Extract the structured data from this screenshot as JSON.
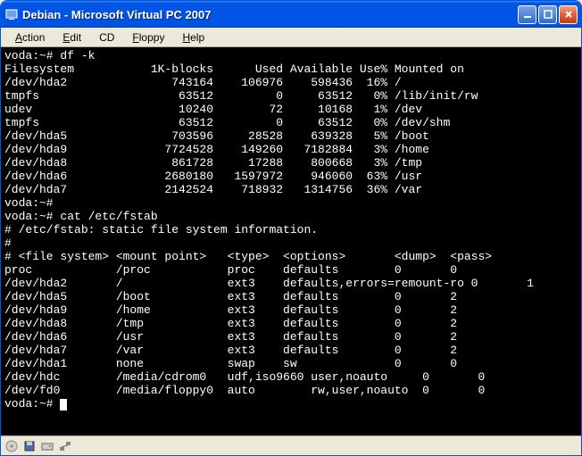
{
  "window": {
    "title": "Debian - Microsoft Virtual PC 2007"
  },
  "menu": {
    "action": "Action",
    "edit": "Edit",
    "cd": "CD",
    "floppy": "Floppy",
    "help": "Help"
  },
  "terminal": {
    "prompt1": "voda:~# df -k",
    "df_header": "Filesystem           1K-blocks      Used Available Use% Mounted on",
    "df_rows": [
      {
        "fs": "/dev/hda2",
        "blocks": "743164",
        "used": "106976",
        "avail": "598436",
        "usep": "16%",
        "mount": "/"
      },
      {
        "fs": "tmpfs",
        "blocks": "63512",
        "used": "0",
        "avail": "63512",
        "usep": "0%",
        "mount": "/lib/init/rw"
      },
      {
        "fs": "udev",
        "blocks": "10240",
        "used": "72",
        "avail": "10168",
        "usep": "1%",
        "mount": "/dev"
      },
      {
        "fs": "tmpfs",
        "blocks": "63512",
        "used": "0",
        "avail": "63512",
        "usep": "0%",
        "mount": "/dev/shm"
      },
      {
        "fs": "/dev/hda5",
        "blocks": "703596",
        "used": "28528",
        "avail": "639328",
        "usep": "5%",
        "mount": "/boot"
      },
      {
        "fs": "/dev/hda9",
        "blocks": "7724528",
        "used": "149260",
        "avail": "7182884",
        "usep": "3%",
        "mount": "/home"
      },
      {
        "fs": "/dev/hda8",
        "blocks": "861728",
        "used": "17288",
        "avail": "800668",
        "usep": "3%",
        "mount": "/tmp"
      },
      {
        "fs": "/dev/hda6",
        "blocks": "2680180",
        "used": "1597972",
        "avail": "946060",
        "usep": "63%",
        "mount": "/usr"
      },
      {
        "fs": "/dev/hda7",
        "blocks": "2142524",
        "used": "718932",
        "avail": "1314756",
        "usep": "36%",
        "mount": "/var"
      }
    ],
    "prompt2": "voda:~#",
    "prompt3": "voda:~# cat /etc/fstab",
    "fstab_comment1": "# /etc/fstab: static file system information.",
    "fstab_comment2": "#",
    "fstab_header": "# <file system> <mount point>   <type>  <options>       <dump>  <pass>",
    "fstab_rows": [
      {
        "fs": "proc",
        "mp": "/proc",
        "type": "proc",
        "opts": "defaults",
        "dump": "0",
        "pass": "0"
      },
      {
        "fs": "/dev/hda2",
        "mp": "/",
        "type": "ext3",
        "opts": "defaults,errors=remount-ro",
        "dump": "0",
        "pass": "1"
      },
      {
        "fs": "/dev/hda5",
        "mp": "/boot",
        "type": "ext3",
        "opts": "defaults",
        "dump": "0",
        "pass": "2"
      },
      {
        "fs": "/dev/hda9",
        "mp": "/home",
        "type": "ext3",
        "opts": "defaults",
        "dump": "0",
        "pass": "2"
      },
      {
        "fs": "/dev/hda8",
        "mp": "/tmp",
        "type": "ext3",
        "opts": "defaults",
        "dump": "0",
        "pass": "2"
      },
      {
        "fs": "/dev/hda6",
        "mp": "/usr",
        "type": "ext3",
        "opts": "defaults",
        "dump": "0",
        "pass": "2"
      },
      {
        "fs": "/dev/hda7",
        "mp": "/var",
        "type": "ext3",
        "opts": "defaults",
        "dump": "0",
        "pass": "2"
      },
      {
        "fs": "/dev/hda1",
        "mp": "none",
        "type": "swap",
        "opts": "sw",
        "dump": "0",
        "pass": "0"
      },
      {
        "fs": "/dev/hdc",
        "mp": "/media/cdrom0",
        "type": "udf,iso9660",
        "opts": "user,noauto",
        "dump": "0",
        "pass": "0"
      },
      {
        "fs": "/dev/fd0",
        "mp": "/media/floppy0",
        "type": "auto",
        "opts": "rw,user,noauto",
        "dump": "0",
        "pass": "0"
      }
    ],
    "prompt4": "voda:~# "
  },
  "icons": {
    "app": "app-icon",
    "status1": "cd-icon",
    "status2": "floppy-icon",
    "status3": "drive-icon",
    "status4": "network-icon"
  }
}
